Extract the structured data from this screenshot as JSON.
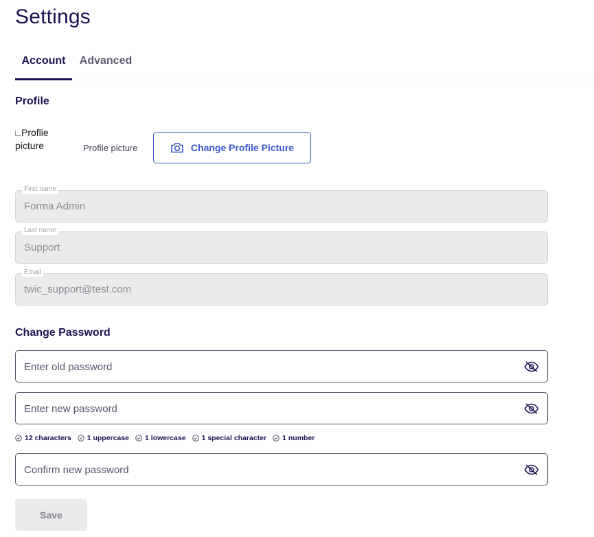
{
  "page": {
    "title": "Settings"
  },
  "tabs": [
    {
      "label": "Account",
      "active": true
    },
    {
      "label": "Advanced",
      "active": false
    }
  ],
  "profile": {
    "section_title": "Profile",
    "avatar_alt": "Proflie picture",
    "picture_label": "Profile picture",
    "change_button_label": "Change Profile Picture",
    "change_button_icon": "camera-icon"
  },
  "fields": {
    "first_name": {
      "label": "First name",
      "value": "Forma Admin"
    },
    "last_name": {
      "label": "Last name",
      "value": "Support"
    },
    "email": {
      "label": "Email",
      "value": "twic_support@test.com"
    }
  },
  "password": {
    "section_title": "Change Password",
    "old_placeholder": "Enter old password",
    "new_placeholder": "Enter new password",
    "confirm_placeholder": "Confirm new password",
    "toggle_icon": "eye-slash-icon",
    "rules": [
      "12 characters",
      "1 uppercase",
      "1 lowercase",
      "1 special character",
      "1 number"
    ],
    "rule_icon": "check-circle-icon"
  },
  "actions": {
    "save_label": "Save"
  },
  "colors": {
    "primary_text": "#1c1352",
    "accent": "#3a57c9",
    "disabled_bg": "#ebebec",
    "border": "#55566a"
  }
}
